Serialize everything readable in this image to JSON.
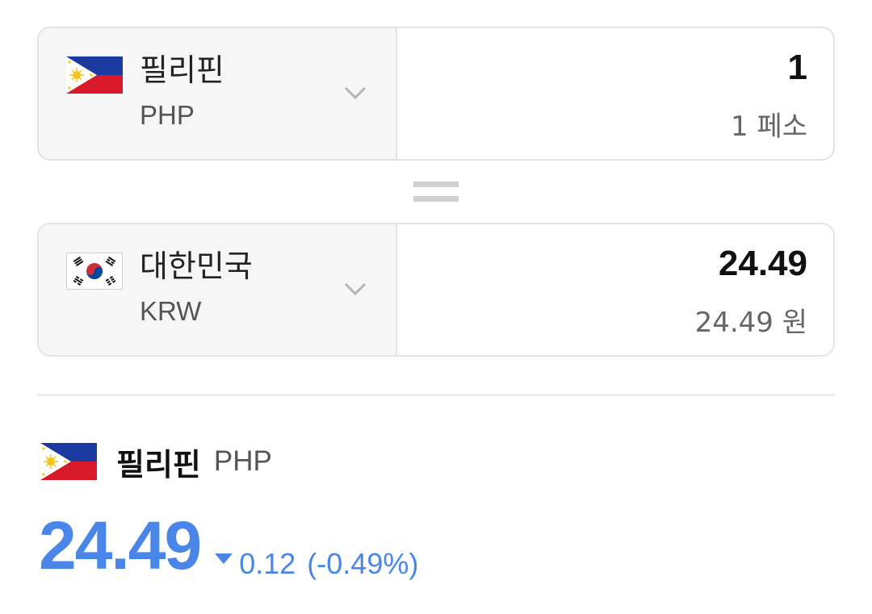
{
  "from": {
    "country": "필리핀",
    "code": "PHP",
    "amount": "1",
    "amount_text": "1 페소",
    "flag_icon": "philippines-flag"
  },
  "to": {
    "country": "대한민국",
    "code": "KRW",
    "amount": "24.49",
    "amount_text": "24.49 원",
    "flag_icon": "south-korea-flag"
  },
  "rate": {
    "country": "필리핀",
    "code": "PHP",
    "value": "24.49",
    "change": "0.12",
    "change_percent": "(-0.49%)",
    "direction": "down"
  },
  "colors": {
    "accent": "#4a86e8",
    "select_bg": "#f6f6f6",
    "border": "#e4e4e4"
  }
}
